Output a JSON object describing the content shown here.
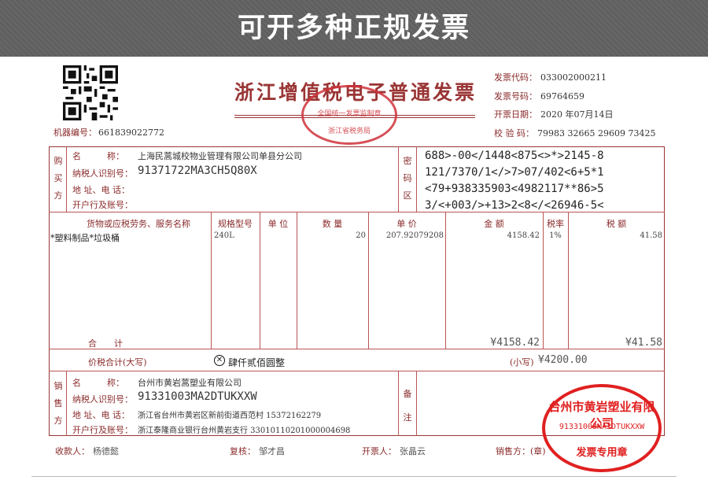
{
  "banner": {
    "text": "可开多种正规发票"
  },
  "invoice": {
    "title": "浙江增值税电子普通发票",
    "seal_title": "全国统一发票监制章",
    "seal_sub": "浙江省税务局",
    "machine_label": "机器编号：",
    "machine_no": "661839022772",
    "code_label": "发票代码：",
    "code": "033002000211",
    "number_label": "发票号码：",
    "number": "69764659",
    "date_label": "开票日期：",
    "date": "2020 年07月14日",
    "check_label": "校 验 码：",
    "check": "79983 32665 29609 73425"
  },
  "buyer": {
    "section": [
      "购",
      "买",
      "方"
    ],
    "name_label": "名　　　称：",
    "name": "上海民蒿城校物业管理有限公司单县分公司",
    "tax_label": "纳税人识别号：",
    "tax_id": "91371722MA3CH5Q80X",
    "addr_label": "地 址、电 话：",
    "bank_label": "开户行及账号："
  },
  "cipher": {
    "section": [
      "密",
      "码",
      "区"
    ],
    "lines": [
      "688>-00</1448<875<>*>2145-8",
      "121/7370/1</>7>07/402<6+5*1",
      "<79+938335903<4982117**86>5",
      "3/<+003/>+13>2<8</<26946-5<"
    ]
  },
  "items": {
    "headers": {
      "name": "货物或应税劳务、服务名称",
      "spec": "规格型号",
      "unit": "单 位",
      "qty": "数 量",
      "price": "单 价",
      "amount": "金 额",
      "rate": "税率",
      "tax": "税 额"
    },
    "rows": [
      {
        "name": "*塑料制品*垃圾桶",
        "spec": "240L",
        "unit": "",
        "qty": "20",
        "price": "207.92079208",
        "amount": "4158.42",
        "rate": "1%",
        "tax": "41.58"
      }
    ],
    "subtotal_label": "合　　计",
    "subtotal_amount": "¥4158.42",
    "subtotal_tax": "¥41.58"
  },
  "totals": {
    "label": "价税合计(大写)",
    "words": "肆仟贰佰圆整",
    "small_label": "(小写)",
    "small_value": "¥4200.00"
  },
  "seller": {
    "section": [
      "销",
      "售",
      "方"
    ],
    "name_label": "名　　　称：",
    "name": "台州市黄岩蒿塑业有限公司",
    "tax_label": "纳税人识别号：",
    "tax_id": "91331003MA2DTUKXXW",
    "addr_label": "地 址、电 话：",
    "addr": "浙江省台州市黄岩区新前街道西范村 15372162279",
    "bank_label": "开户行及账号：",
    "bank": "浙江泰隆商业银行台州黄岩支行 33010110201000004698"
  },
  "remarks": {
    "section": [
      "备",
      "注"
    ]
  },
  "seller_seal": {
    "top": "台州市黄岩塑业有限公司",
    "number": "91331003MA2DTUKXXW",
    "bottom": "发票专用章"
  },
  "footer": {
    "payee_label": "收款人：",
    "payee": "杨德懿",
    "reviewer_label": "复核：",
    "reviewer": "邹才昌",
    "drawer_label": "开票人：",
    "drawer": "张晶云",
    "seller_label": "销售方：(章)"
  }
}
